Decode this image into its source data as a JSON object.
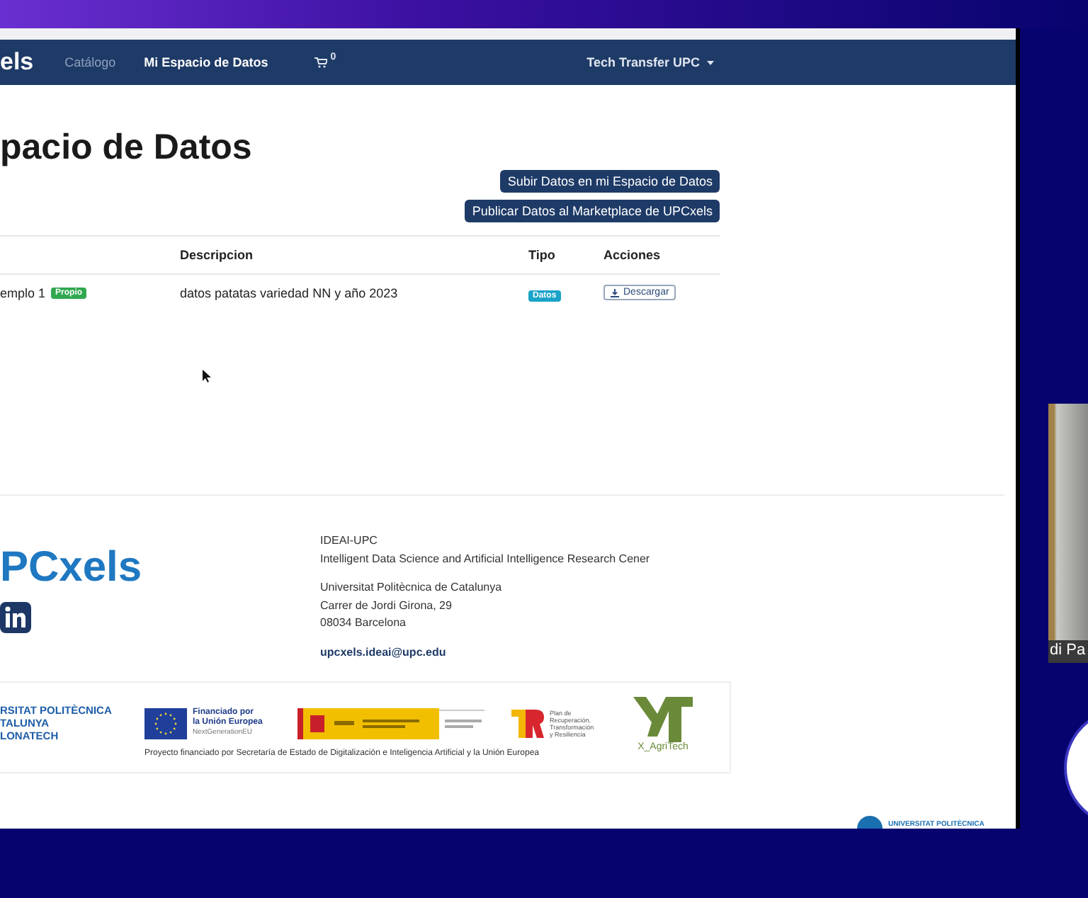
{
  "navbar": {
    "brand": "els",
    "links": [
      {
        "label": "Catálogo",
        "selected": false
      },
      {
        "label": "Mi Espacio de Datos",
        "selected": true
      }
    ],
    "cart_count": "0",
    "user_menu": "Tech Transfer UPC"
  },
  "page": {
    "title": "pacio de Datos",
    "buttons": [
      "Subir Datos en mi Espacio de Datos",
      "Publicar Datos al Marketplace de UPCxels"
    ]
  },
  "table": {
    "columns": [
      "",
      "Descripcion",
      "Tipo",
      "Acciones"
    ],
    "rows": [
      {
        "name": "emplo 1",
        "badge": "Propio",
        "description": "datos patatas variedad NN y año 2023",
        "type": "Datos",
        "action": "Descargar"
      }
    ]
  },
  "footer": {
    "logo": "PCxels",
    "org": "IDEAI-UPC",
    "org_full": "Intelligent Data Science and Artificial Intelligence Research Cener",
    "address": [
      "Universitat Politècnica de Catalunya",
      "Carrer de Jordi Girona, 29",
      "08034 Barcelona"
    ],
    "email": "upcxels.ideai@upc.edu",
    "upc_logo": [
      "RSITAT POLITÈCNICA",
      "TALUNYA",
      "LONATECH"
    ],
    "eu": [
      "Financiado por",
      "la Unión Europea",
      "NextGenerationEU"
    ],
    "plan": [
      "Plan de",
      "Recuperación,",
      "Transformación",
      "y Resiliencia"
    ],
    "agritech": "X_AgriTech",
    "funding_note": "Proyecto financiado por Secretaría de Estado de Digitalización e Inteligencia Artificial y la Unión Europea",
    "corner_logo": "UNIVERSITAT POLITÈCNICA"
  },
  "participant": {
    "name": "di Pa"
  }
}
